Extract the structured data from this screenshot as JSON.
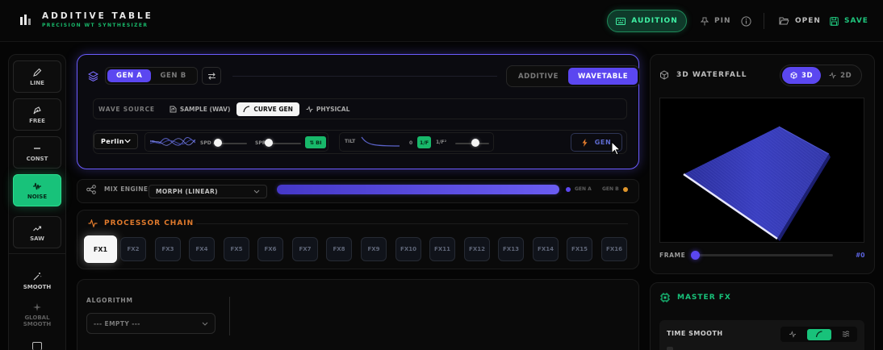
{
  "header": {
    "title": "ADDITIVE TABLE",
    "subtitle": "PRECISION WT SYNTHESIZER",
    "audition_label": "AUDITION",
    "pin_label": "PIN",
    "open_label": "OPEN",
    "save_label": "SAVE"
  },
  "generators": [
    {
      "label": "LINE",
      "icon": "pencil-icon"
    },
    {
      "label": "FREE",
      "icon": "pen-nib-icon"
    },
    {
      "label": "CONST",
      "icon": "minus-icon"
    },
    {
      "label": "NOISE",
      "icon": "noise-icon",
      "active": true
    },
    {
      "label": "SAW",
      "icon": "trend-up-icon"
    }
  ],
  "tools": [
    {
      "label": "SMOOTH",
      "icon": "wand-icon"
    },
    {
      "label": "GLOBAL SMOOTH",
      "icon": "sparkle-icon"
    }
  ],
  "gen_panel": {
    "gen_tabs": [
      "GEN A",
      "GEN B"
    ],
    "gen_active": "GEN A",
    "mode_tabs": [
      "ADDITIVE",
      "WAVETABLE"
    ],
    "mode_active": "WAVETABLE",
    "wave_source_label": "WAVE SOURCE",
    "sources": [
      "SAMPLE (WAV)",
      "CURVE GEN",
      "PHYSICAL"
    ],
    "source_active": "CURVE GEN",
    "noise_type": "Perlin",
    "spd_label": "SPD",
    "spd_value": 0.15,
    "spr_label": "SPR",
    "spr_value": 0.05,
    "bi_label": "⇅ BI",
    "tilt_label": "TILT",
    "tilt_zero": "0",
    "tilt_1f": "1/F",
    "tilt_1f2": "1/F²",
    "tilt_value": 0.6,
    "gen_button": "GEN"
  },
  "mix": {
    "label": "MIX ENGINE",
    "mode": "MORPH (LINEAR)",
    "gen_a": "GEN A",
    "gen_b": "GEN B"
  },
  "processor": {
    "title": "PROCESSOR CHAIN",
    "slots": [
      "FX1",
      "FX2",
      "FX3",
      "FX4",
      "FX5",
      "FX6",
      "FX7",
      "FX8",
      "FX9",
      "FX10",
      "FX11",
      "FX12",
      "FX13",
      "FX14",
      "FX15",
      "FX16"
    ],
    "active": "FX1"
  },
  "algorithm": {
    "label": "ALGORITHM",
    "value": "--- EMPTY ---"
  },
  "waterfall": {
    "title": "3D WATERFALL",
    "view_3d": "3D",
    "view_2d": "2D",
    "view_active": "3D",
    "frame_label": "FRAME",
    "frame_value": "#0"
  },
  "master_fx": {
    "title": "MASTER FX",
    "time_smooth_label": "TIME SMOOTH"
  },
  "colors": {
    "accent_violet": "#5b47f0",
    "accent_green": "#18c27a",
    "accent_orange": "#e07a2c"
  }
}
